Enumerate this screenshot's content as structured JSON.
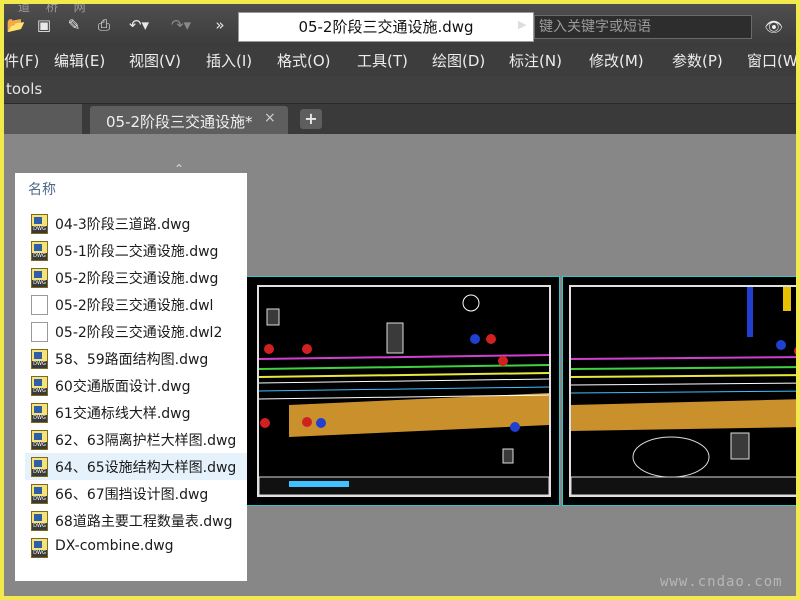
{
  "titlebar": {
    "document_title": "05-2阶段三交通设施.dwg",
    "search_placeholder": "键入关键字或短语",
    "quick_access": [
      "open-icon",
      "save-icon",
      "save-as-icon",
      "print-icon",
      "undo-icon",
      "redo-icon",
      "more-icon"
    ],
    "watermark_top": "道 桥 网"
  },
  "menubar": {
    "items": [
      "件(F)",
      "编辑(E)",
      "视图(V)",
      "插入(I)",
      "格式(O)",
      "工具(T)",
      "绘图(D)",
      "标注(N)",
      "修改(M)",
      "参数(P)",
      "窗口(W"
    ]
  },
  "toolsbar": {
    "label": "tools"
  },
  "tabs": {
    "active_label": "05-2阶段三交通设施*",
    "close_glyph": "×",
    "add_glyph": "+"
  },
  "file_panel": {
    "header": "名称",
    "files": [
      {
        "name": "04-3阶段三道路.dwg",
        "type": "dwg"
      },
      {
        "name": "05-1阶段二交通设施.dwg",
        "type": "dwg"
      },
      {
        "name": "05-2阶段三交通设施.dwg",
        "type": "dwg"
      },
      {
        "name": "05-2阶段三交通设施.dwl",
        "type": "blank"
      },
      {
        "name": "05-2阶段三交通设施.dwl2",
        "type": "blank"
      },
      {
        "name": "58、59路面结构图.dwg",
        "type": "dwg"
      },
      {
        "name": "60交通版面设计.dwg",
        "type": "dwg"
      },
      {
        "name": "61交通标线大样.dwg",
        "type": "dwg"
      },
      {
        "name": "62、63隔离护栏大样图.dwg",
        "type": "dwg"
      },
      {
        "name": "64、65设施结构大样图.dwg",
        "type": "dwg",
        "selected": true
      },
      {
        "name": "66、67围挡设计图.dwg",
        "type": "dwg"
      },
      {
        "name": "68道路主要工程数量表.dwg",
        "type": "dwg"
      },
      {
        "name": "DX-combine.dwg",
        "type": "dwg"
      }
    ]
  },
  "watermark": "www.cndao.com",
  "colors": {
    "frame_border": "#f2ea4c",
    "canvas": "#878787",
    "sheet_border": "#2fc7c7",
    "road_fill": "#e0a030",
    "selected_row": "#e5f1fb"
  }
}
